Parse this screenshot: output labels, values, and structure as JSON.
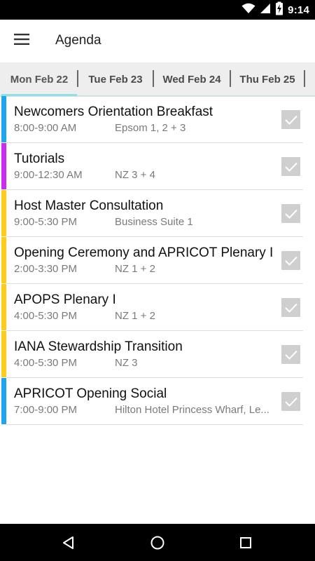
{
  "status_bar": {
    "time": "9:14",
    "icons": [
      "wifi-icon",
      "cell-signal-icon",
      "battery-charging-icon"
    ]
  },
  "app_bar": {
    "menu_icon": "hamburger-menu-icon",
    "title": "Agenda"
  },
  "tabs": [
    {
      "label": "Mon Feb 22",
      "active": true
    },
    {
      "label": "Tue Feb 23",
      "active": false
    },
    {
      "label": "Wed Feb 24",
      "active": false
    },
    {
      "label": "Thu Feb 25",
      "active": false
    }
  ],
  "colors": {
    "accent_tab": "#8ee0e8",
    "blue": "#1ea5f2",
    "purple": "#cc2bf0",
    "yellow": "#ffcc17"
  },
  "agenda": [
    {
      "title": "Newcomers Orientation Breakfast",
      "time": "8:00-9:00 AM",
      "location": "Epsom 1, 2 + 3",
      "color": "#1ea5f2",
      "checked_icon": "checkmark-icon"
    },
    {
      "title": "Tutorials",
      "time": "9:00-12:30 AM",
      "location": "NZ 3 + 4",
      "color": "#cc2bf0",
      "checked_icon": "checkmark-icon"
    },
    {
      "title": "Host Master Consultation",
      "time": "9:00-5:30 PM",
      "location": "Business Suite 1",
      "color": "#ffcc17",
      "checked_icon": "checkmark-icon"
    },
    {
      "title": "Opening Ceremony and APRICOT Plenary I",
      "time": "2:00-3:30 PM",
      "location": "NZ 1 + 2",
      "color": "#ffcc17",
      "checked_icon": "checkmark-icon"
    },
    {
      "title": "APOPS Plenary I",
      "time": "4:00-5:30 PM",
      "location": "NZ 1 + 2",
      "color": "#ffcc17",
      "checked_icon": "checkmark-icon"
    },
    {
      "title": "IANA Stewardship Transition",
      "time": "4:00-5:30 PM",
      "location": "NZ 3",
      "color": "#ffcc17",
      "checked_icon": "checkmark-icon"
    },
    {
      "title": "APRICOT Opening Social",
      "time": "7:00-9:00 PM",
      "location": "Hilton Hotel Princess Wharf, Le...",
      "color": "#1ea5f2",
      "checked_icon": "checkmark-icon"
    }
  ],
  "nav_bar": {
    "icons": [
      "back-icon",
      "home-icon",
      "recents-icon"
    ]
  }
}
